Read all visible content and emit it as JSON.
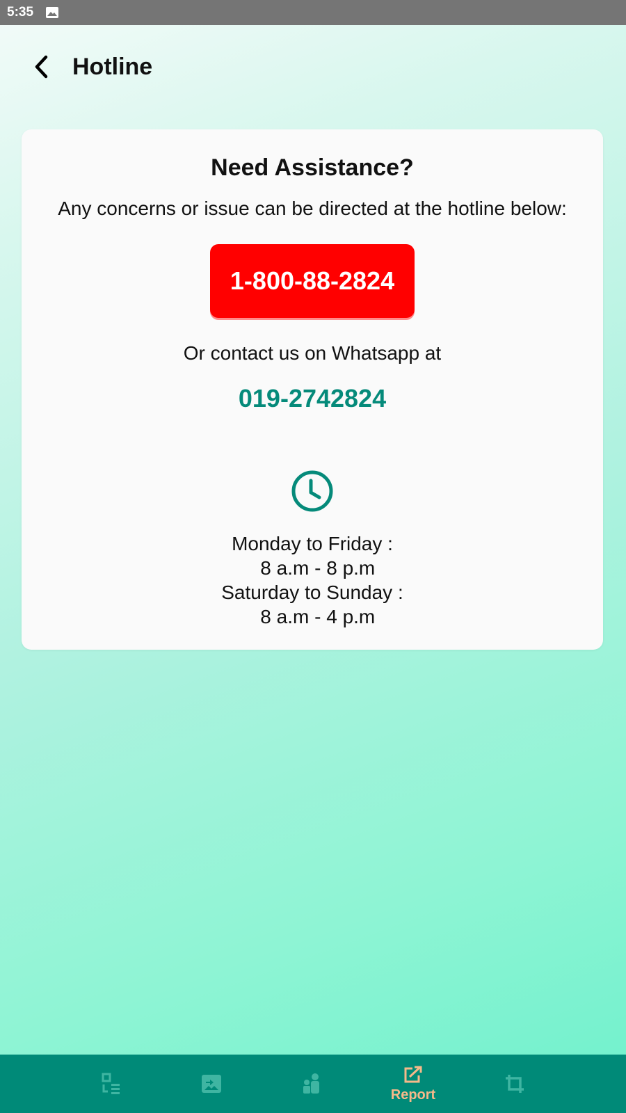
{
  "status_bar": {
    "time": "5:35",
    "icons": [
      "image-icon"
    ]
  },
  "app_bar": {
    "title": "Hotline",
    "back_icon": "chevron-left-icon"
  },
  "card": {
    "title": "Need Assistance?",
    "subtitle": "Any concerns or issue can be directed at the hotline below:",
    "hotline_number": "1-800-88-2824",
    "whatsapp_text": "Or contact us on Whatsapp at",
    "whatsapp_number": "019-2742824",
    "clock_icon": "clock-icon",
    "hours": {
      "weekday_label": "Monday to Friday :",
      "weekday_time": "  8 a.m - 8 p.m",
      "weekend_label": "Saturday to Sunday :",
      "weekend_time": "  8 a.m - 4 p.m"
    }
  },
  "bottom_nav": {
    "items": [
      {
        "icon": "checklist-icon",
        "label": ""
      },
      {
        "icon": "image-swap-icon",
        "label": ""
      },
      {
        "icon": "people-icon",
        "label": ""
      },
      {
        "icon": "report-icon",
        "label": "Report",
        "active": true
      },
      {
        "icon": "crop-icon",
        "label": ""
      }
    ]
  },
  "colors": {
    "accent": "#008a78",
    "hotline_red": "#ff0000",
    "active_nav": "#f6b98a",
    "inactive_nav": "#3fb5a2"
  }
}
